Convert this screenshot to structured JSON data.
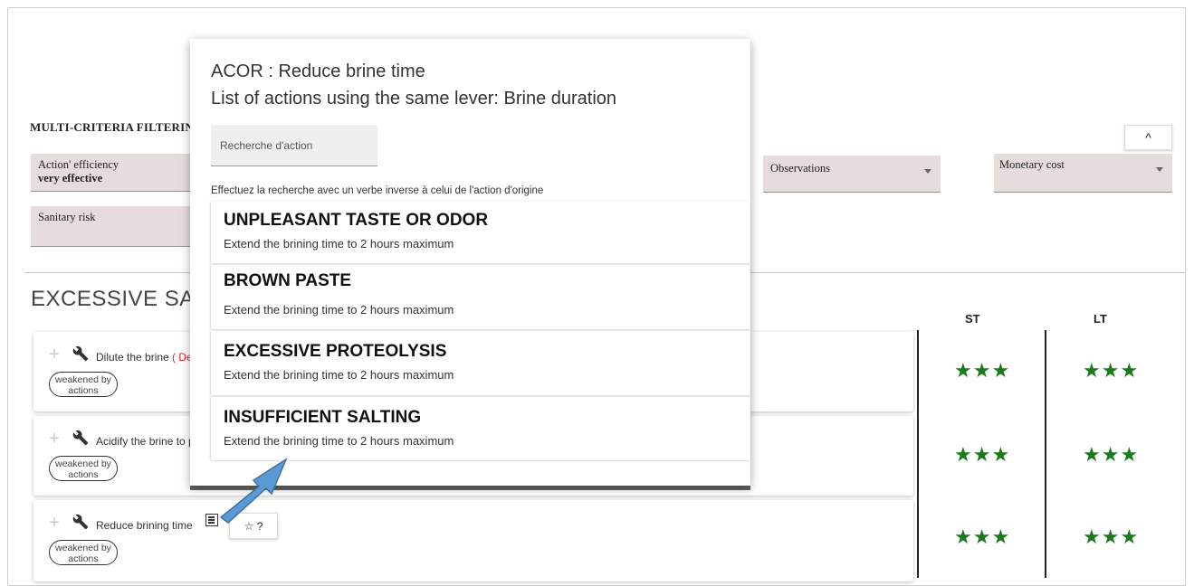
{
  "filters": {
    "title": "MULTI-CRITERIA FILTERIN",
    "efficiency_label": "Action' efficiency",
    "efficiency_value": "very effective",
    "sanitary_label": "Sanitary risk",
    "observations_label": "Observations",
    "monetary_label": "Monetary cost",
    "collapse_icon": "^"
  },
  "section": {
    "title": "EXCESSIVE SALT",
    "col_st": "ST",
    "col_lt": "LT"
  },
  "actions": [
    {
      "name": "Dilute the brine",
      "extra": " ( Der",
      "tag": "weakened by actions",
      "st": "★★★",
      "lt": "★★★"
    },
    {
      "name": "Acidify the brine to p",
      "extra": "",
      "tag": "weakened by actions",
      "st": "★★★",
      "lt": "★★★"
    },
    {
      "name": "Reduce brining time",
      "extra": "",
      "tag": "weakened by actions",
      "st": "★★★",
      "lt": "★★★",
      "fav_label": "☆ ?"
    }
  ],
  "modal": {
    "title_line1": "ACOR : Reduce brine time",
    "title_line2": "List of actions using the same lever: Brine duration",
    "search_placeholder": "Recherche d'action",
    "hint": "Effectuez la recherche avec un verbe inverse à celui de l'action d'origine",
    "items": [
      {
        "title": "UNPLEASANT TASTE OR ODOR",
        "desc": "Extend the brining time to 2 hours maximum"
      },
      {
        "title": "BROWN PASTE",
        "desc": "Extend the brining time to 2 hours maximum"
      },
      {
        "title": "EXCESSIVE PROTEOLYSIS",
        "desc": "Extend the brining time to 2 hours maximum"
      },
      {
        "title": "INSUFFICIENT SALTING",
        "desc": "Extend the brining time to 2 hours maximum"
      }
    ]
  },
  "colors": {
    "star_green": "#1a7a1a",
    "field_bg": "#e6dcdc",
    "arrow_blue": "#5b9bd5",
    "danger_red": "#e02020"
  }
}
